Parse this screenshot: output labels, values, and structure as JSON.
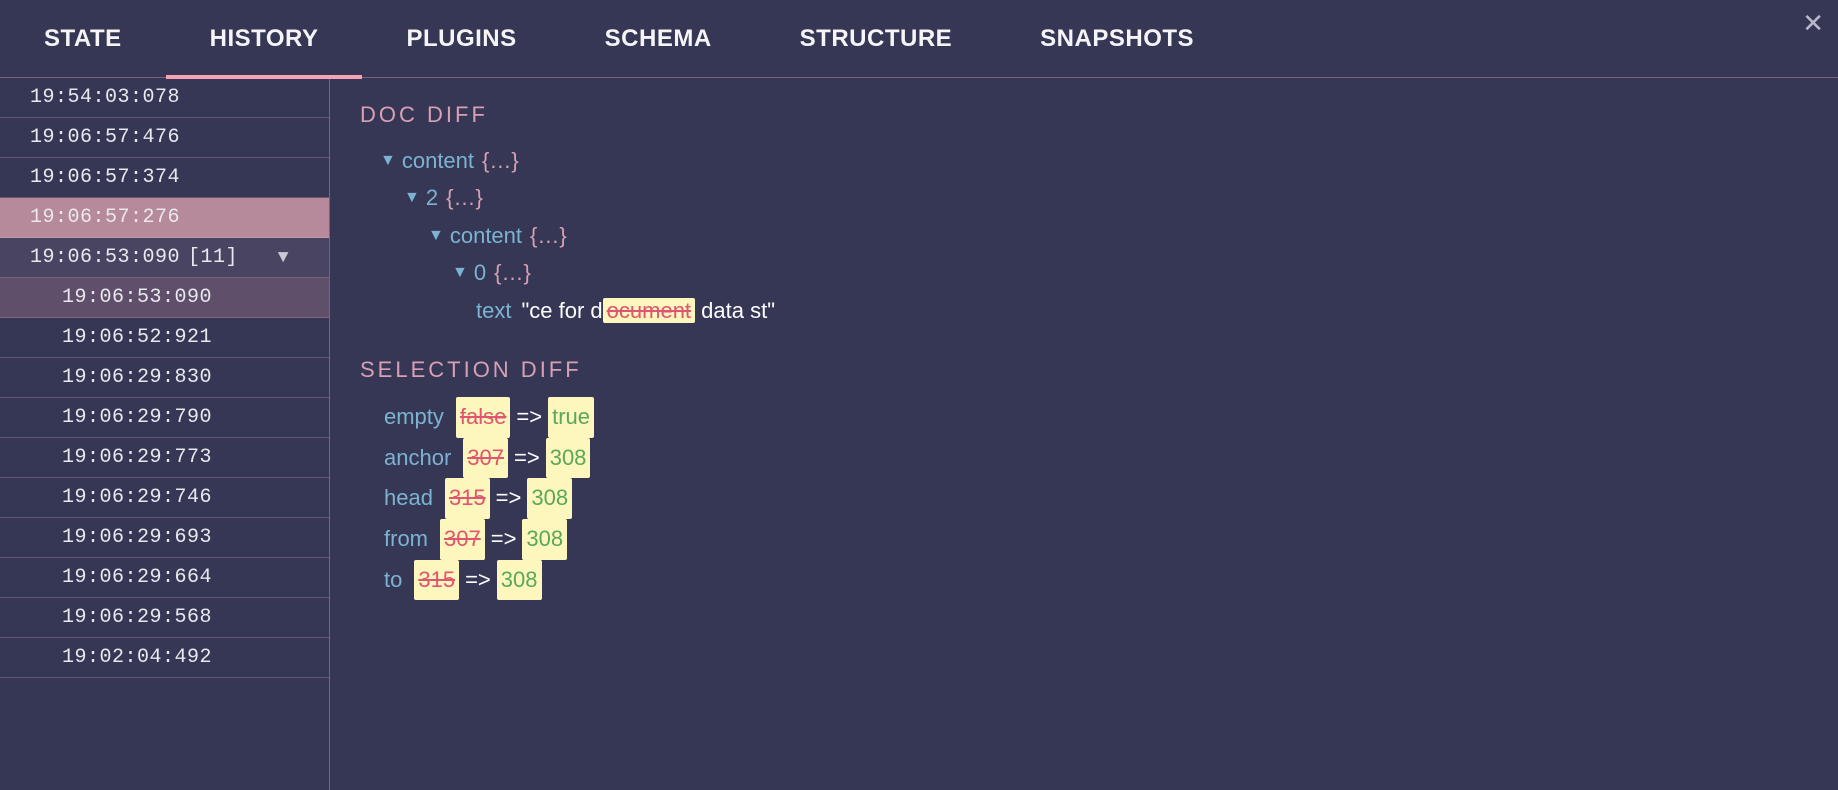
{
  "tabs": {
    "state": "STATE",
    "history": "HISTORY",
    "plugins": "PLUGINS",
    "schema": "SCHEMA",
    "structure": "STRUCTURE",
    "snapshots": "SNAPSHOTS",
    "active": "history"
  },
  "history": {
    "items": [
      {
        "time": "19:54:03:078",
        "selected": false,
        "indented": false
      },
      {
        "time": "19:06:57:476",
        "selected": false,
        "indented": false
      },
      {
        "time": "19:06:57:374",
        "selected": false,
        "indented": false
      },
      {
        "time": "19:06:57:276",
        "selected": true,
        "indented": false
      },
      {
        "time": "19:06:53:090",
        "badge": "[11]",
        "group": true,
        "expanded": true,
        "indented": false
      },
      {
        "time": "19:06:53:090",
        "sub_selected": true,
        "indented": true
      },
      {
        "time": "19:06:52:921",
        "indented": true
      },
      {
        "time": "19:06:29:830",
        "indented": true
      },
      {
        "time": "19:06:29:790",
        "indented": true
      },
      {
        "time": "19:06:29:773",
        "indented": true
      },
      {
        "time": "19:06:29:746",
        "indented": true
      },
      {
        "time": "19:06:29:693",
        "indented": true
      },
      {
        "time": "19:06:29:664",
        "indented": true
      },
      {
        "time": "19:06:29:568",
        "indented": true
      },
      {
        "time": "19:02:04:492",
        "indented": true
      }
    ]
  },
  "doc_diff": {
    "title": "DOC DIFF",
    "tree": {
      "k0": "content",
      "k1": "2",
      "k2": "content",
      "k3": "0",
      "k4": "text",
      "braces": "{…}",
      "text_prefix": "\"ce for d",
      "text_removed": "ocument",
      "text_suffix": " data st\""
    }
  },
  "selection_diff": {
    "title": "SELECTION DIFF",
    "rows": [
      {
        "key": "empty",
        "from": "false",
        "to": "true"
      },
      {
        "key": "anchor",
        "from": "307",
        "to": "308"
      },
      {
        "key": "head",
        "from": "315",
        "to": "308"
      },
      {
        "key": "from",
        "from": "307",
        "to": "308"
      },
      {
        "key": "to",
        "from": "315",
        "to": "308"
      }
    ],
    "arrow": "=>"
  },
  "colors": {
    "bg": "#363755",
    "accent": "#f5a3b7",
    "key": "#7bb3d1",
    "removed_text": "#e05570",
    "added_text": "#5aa85a",
    "highlight_bg": "#fdf6bd"
  }
}
